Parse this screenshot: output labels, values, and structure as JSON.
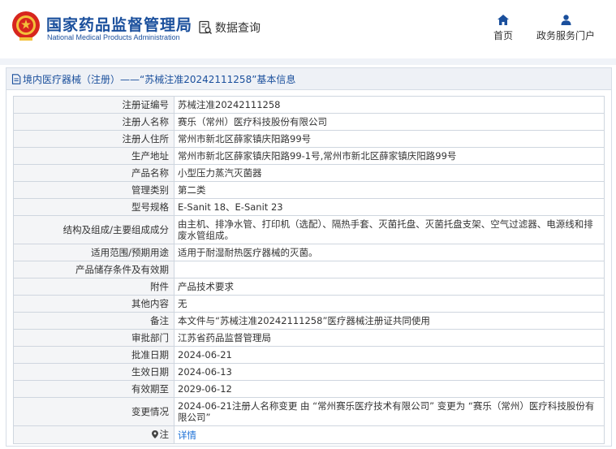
{
  "header": {
    "org_name_cn": "国家药品监督管理局",
    "org_name_en": "National Medical Products Administration",
    "query_label": "数据查询",
    "nav": [
      {
        "label": "首页",
        "icon": "home-icon"
      },
      {
        "label": "政务服务门户",
        "icon": "user-icon"
      }
    ]
  },
  "panel": {
    "title": "境内医疗器械（注册）——“苏械注准20242111258”基本信息",
    "rows": [
      {
        "key": "注册证编号",
        "value": "苏械注准20242111258"
      },
      {
        "key": "注册人名称",
        "value": "赛乐（常州）医疗科技股份有限公司"
      },
      {
        "key": "注册人住所",
        "value": "常州市新北区薛家镇庆阳路99号"
      },
      {
        "key": "生产地址",
        "value": "常州市新北区薛家镇庆阳路99-1号,常州市新北区薛家镇庆阳路99号"
      },
      {
        "key": "产品名称",
        "value": "小型压力蒸汽灭菌器"
      },
      {
        "key": "管理类别",
        "value": "第二类"
      },
      {
        "key": "型号规格",
        "value": "E-Sanit 18、E-Sanit 23"
      },
      {
        "key": "结构及组成/主要组成成分",
        "value": "由主机、排净水管、打印机（选配）、隔热手套、灭菌托盘、灭菌托盘支架、空气过滤器、电源线和排废水管组成。"
      },
      {
        "key": "适用范围/预期用途",
        "value": "适用于耐湿耐热医疗器械的灭菌。"
      },
      {
        "key": "产品储存条件及有效期",
        "value": ""
      },
      {
        "key": "附件",
        "value": "产品技术要求"
      },
      {
        "key": "其他内容",
        "value": "无"
      },
      {
        "key": "备注",
        "value": "本文件与“苏械注准20242111258”医疗器械注册证共同使用"
      },
      {
        "key": "审批部门",
        "value": "江苏省药品监督管理局"
      },
      {
        "key": "批准日期",
        "value": "2024-06-21"
      },
      {
        "key": "生效日期",
        "value": "2024-06-13"
      },
      {
        "key": "有效期至",
        "value": "2029-06-12"
      },
      {
        "key": "变更情况",
        "value": "2024-06-21注册人名称变更 由 “常州赛乐医疗技术有限公司” 变更为 “赛乐（常州）医疗科技股份有限公司”"
      }
    ],
    "note": {
      "key": "注",
      "link": "详情"
    }
  }
}
